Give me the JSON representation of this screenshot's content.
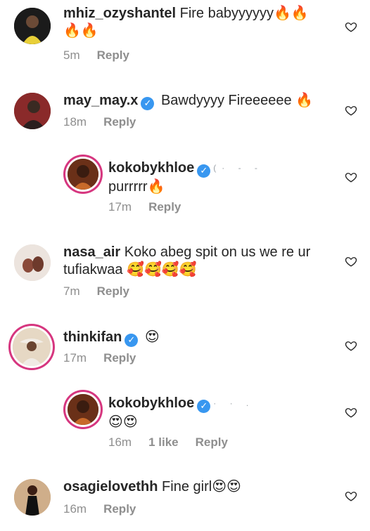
{
  "comments": [
    {
      "username": "mhiz_ozyshantel",
      "text_line1": "Fire babyyyyyy",
      "emoji_line1": "🔥🔥",
      "emoji_line2": "🔥🔥",
      "time": "5m",
      "reply_label": "Reply"
    },
    {
      "username": "may_may.x",
      "text_line1": "Bawdyyyy Fireeeeee",
      "emoji_line1": "🔥",
      "time": "18m",
      "reply_label": "Reply"
    },
    {
      "username": "kokobykhloe",
      "text_line1": "purrrrr",
      "emoji_line1": "🔥",
      "time": "17m",
      "reply_label": "Reply"
    },
    {
      "username": "nasa_air",
      "text_line1": "Koko abeg spit on us we re ur",
      "text_line2": "tufiakwaa",
      "emoji_line2": "🥰🥰🥰🥰",
      "time": "7m",
      "reply_label": "Reply"
    },
    {
      "username": "thinkifan",
      "emoji_line1": "😍",
      "time": "17m",
      "reply_label": "Reply"
    },
    {
      "username": "kokobykhloe",
      "emoji_line2": "😍😍",
      "time": "16m",
      "likes": "1 like",
      "reply_label": "Reply"
    },
    {
      "username": "osagielovethh",
      "text_line1": "Fine girl",
      "emoji_line1": "😍😍",
      "time": "16m",
      "reply_label": "Reply"
    }
  ]
}
